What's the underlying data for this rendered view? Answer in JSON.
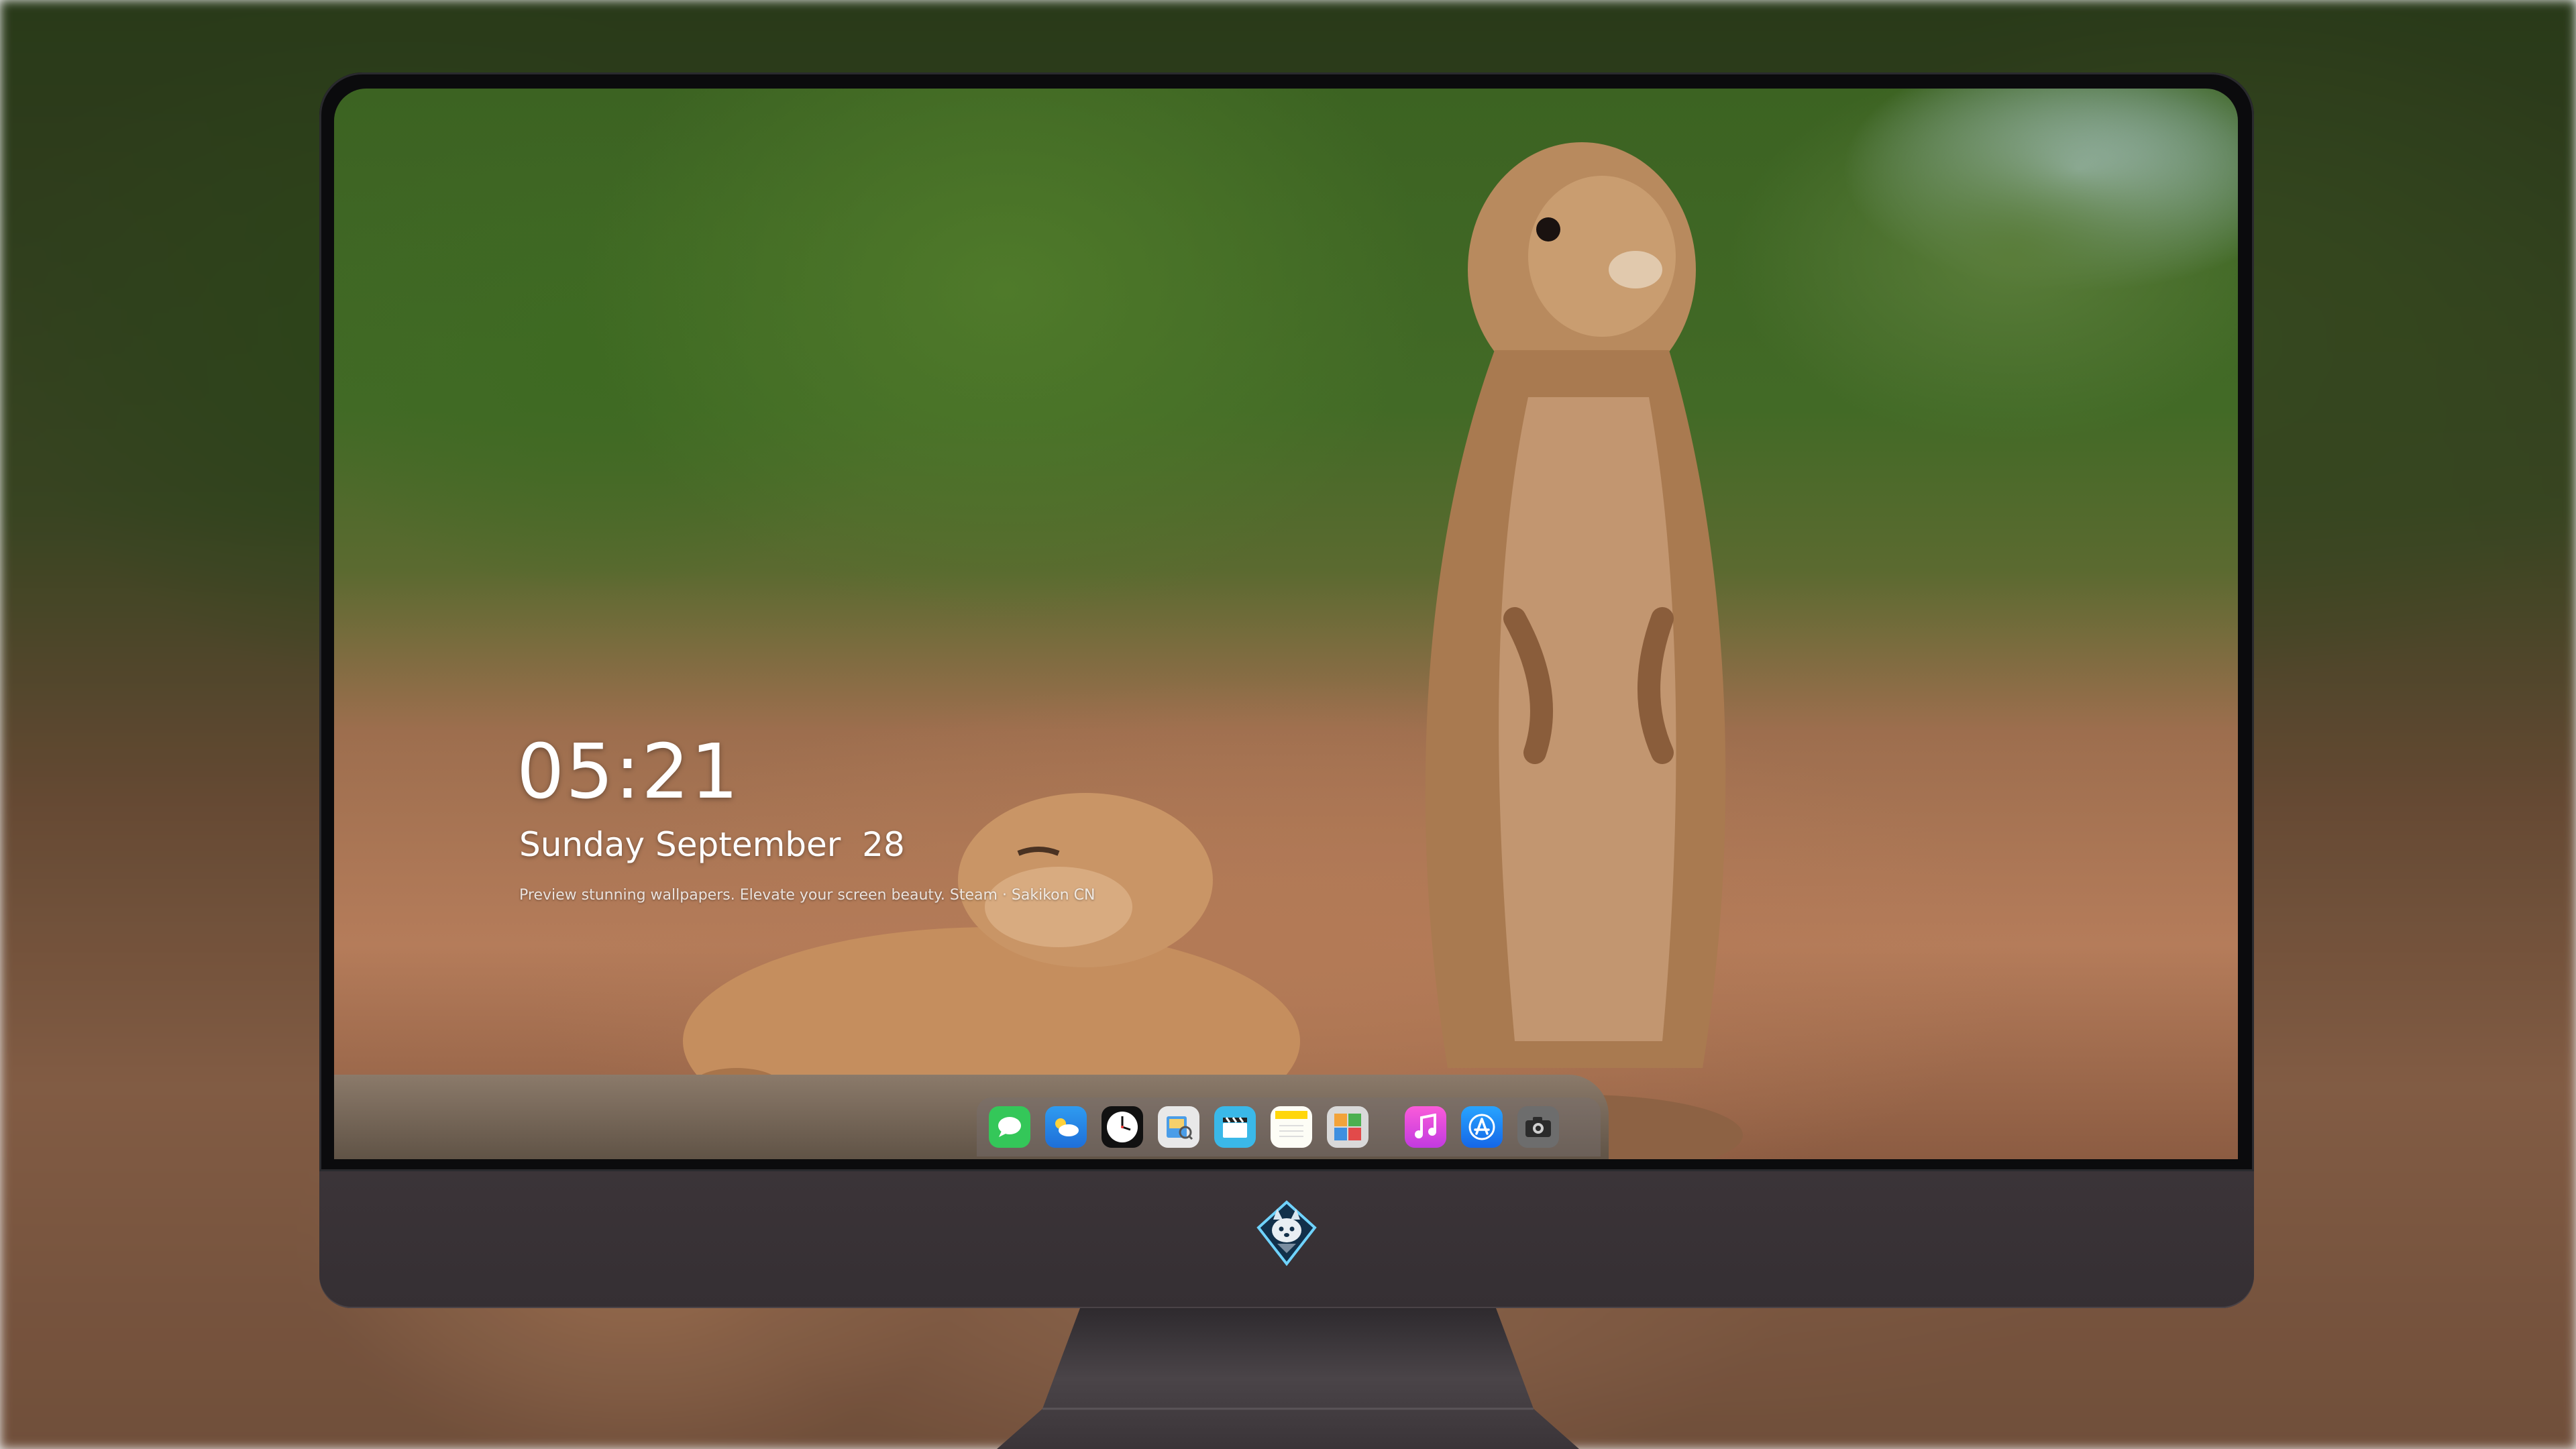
{
  "lock_screen": {
    "time": "05:21",
    "date": "Sunday September  28",
    "tagline": "Preview stunning wallpapers. Elevate your screen beauty. Steam · Sakikon CN"
  },
  "dock": {
    "apps": [
      {
        "name": "Messages",
        "icon": "messages-icon",
        "color": "#34c759"
      },
      {
        "name": "Weather",
        "icon": "weather-icon",
        "color": "#2f9bf0"
      },
      {
        "name": "Clock",
        "icon": "clock-icon",
        "color": "#111111"
      },
      {
        "name": "Preview",
        "icon": "preview-icon",
        "color": "#e8e8e8"
      },
      {
        "name": "Clips",
        "icon": "clapperboard-icon",
        "color": "#3ab8e8"
      },
      {
        "name": "Notes",
        "icon": "notes-icon",
        "color": "#ffd60a"
      },
      {
        "name": "Photo Booth",
        "icon": "gallery-icon",
        "color": "#d9d9d9"
      },
      {
        "name": "Music",
        "icon": "music-icon",
        "color": "#f13bd1"
      },
      {
        "name": "App Store",
        "icon": "app-store-icon",
        "color": "#1c8ef9"
      },
      {
        "name": "Camera",
        "icon": "camera-icon",
        "color": "#6d6d6d"
      }
    ]
  },
  "branding": {
    "chin_logo": "husky-mascot-logo"
  },
  "colors": {
    "bezel": "#0b0b0d",
    "chin": "#3b3438",
    "stand": "#3a3438"
  }
}
